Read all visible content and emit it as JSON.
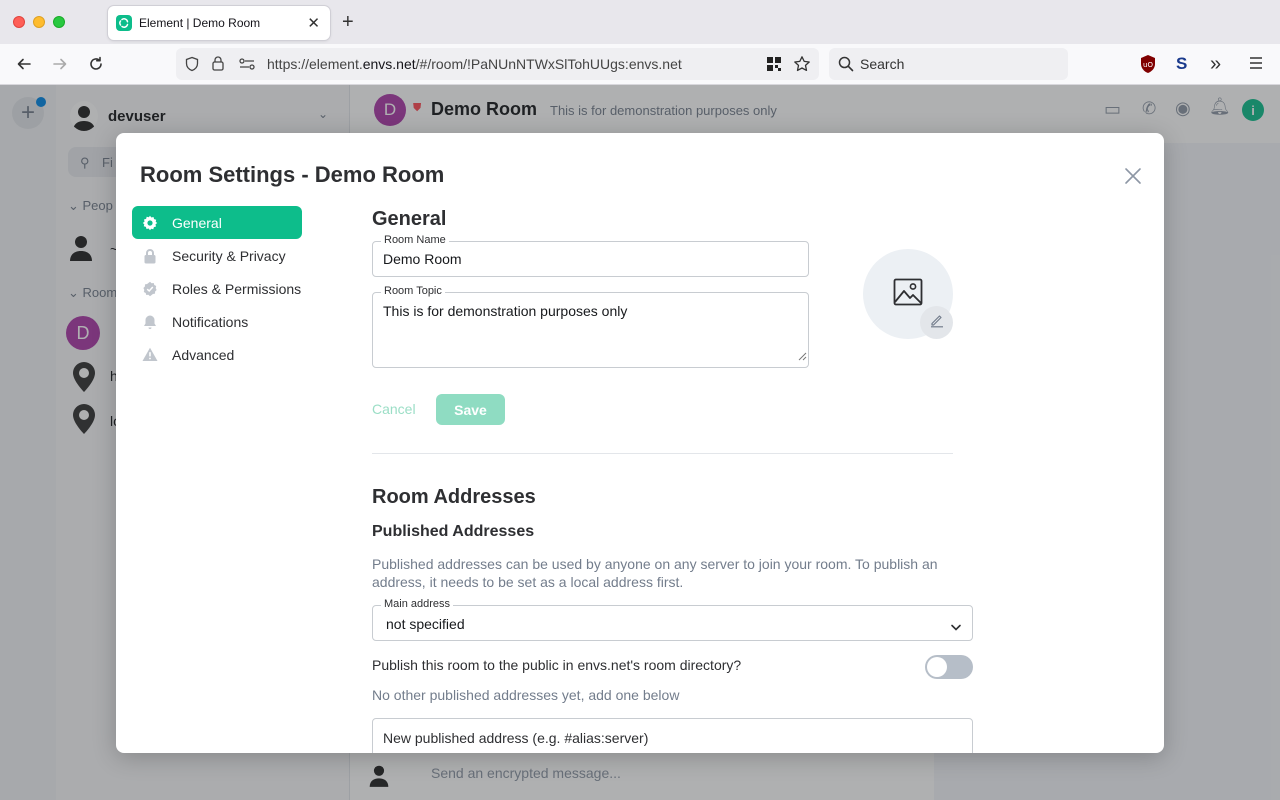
{
  "browser": {
    "tab_title": "Element | Demo Room",
    "url_prefix": "https://element.",
    "url_domain": "envs.net",
    "url_suffix": "/#/room/!PaNUnNTWxSlTohUUgs:envs.net",
    "search_placeholder": "Search"
  },
  "app": {
    "user_name": "devuser",
    "filter_placeholder": "Fi",
    "section_people": "Peop",
    "section_rooms": "Room",
    "room_initial": "D",
    "room_name": "Demo Room",
    "room_topic": "This is for demonstration purposes only",
    "composer_placeholder": "Send an encrypted message...",
    "people_item_char": "~",
    "room_item_1_char": "D",
    "room_item_2_char": "h",
    "room_item_3_char": "lo"
  },
  "dialog": {
    "title": "Room Settings - Demo Room",
    "tabs": [
      {
        "label": "General",
        "icon": "gear-icon"
      },
      {
        "label": "Security & Privacy",
        "icon": "lock-icon"
      },
      {
        "label": "Roles & Permissions",
        "icon": "badge-icon"
      },
      {
        "label": "Notifications",
        "icon": "bell-icon"
      },
      {
        "label": "Advanced",
        "icon": "warning-icon"
      }
    ],
    "general": {
      "heading": "General",
      "room_name_label": "Room Name",
      "room_name_value": "Demo Room",
      "room_topic_label": "Room Topic",
      "room_topic_value": "This is for demonstration purposes only",
      "cancel_label": "Cancel",
      "save_label": "Save"
    },
    "addresses": {
      "heading": "Room Addresses",
      "published_heading": "Published Addresses",
      "published_description": "Published addresses can be used by anyone on any server to join your room. To publish an address, it needs to be set as a local address first.",
      "main_address_label": "Main address",
      "main_address_value": "not specified",
      "publish_label": "Publish this room to the public in envs.net's room directory?",
      "publish_enabled": false,
      "no_other": "No other published addresses yet, add one below",
      "new_address_placeholder": "New published address (e.g. #alias:server)"
    }
  },
  "colors": {
    "accent": "#0dbd8b",
    "room_avatar": "#ac3ba8",
    "muted_text": "#737d8c"
  }
}
